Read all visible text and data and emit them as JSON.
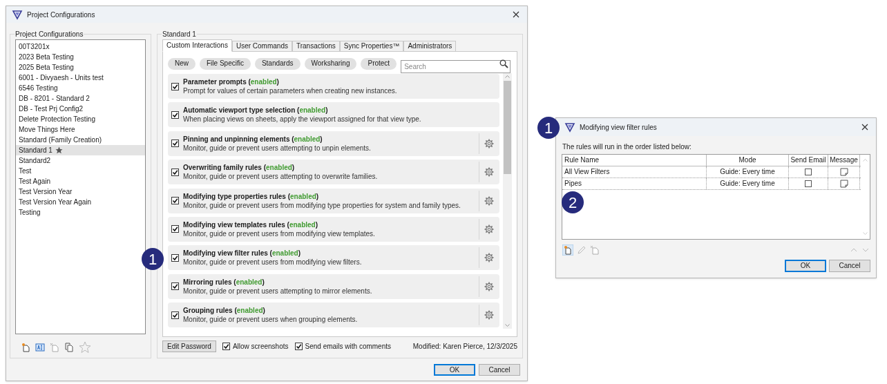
{
  "main_window": {
    "title": "Project Configurations",
    "configurations": {
      "title": "Project Configurations",
      "items": [
        {
          "label": "00T3201x",
          "selected": false,
          "starred": false
        },
        {
          "label": "2023 Beta Testing",
          "selected": false,
          "starred": false
        },
        {
          "label": "2025 Beta Testing",
          "selected": false,
          "starred": false
        },
        {
          "label": "6001 - Divyaesh - Units test",
          "selected": false,
          "starred": false
        },
        {
          "label": "6546 Testing",
          "selected": false,
          "starred": false
        },
        {
          "label": "DB - 8201 - Standard 2",
          "selected": false,
          "starred": false
        },
        {
          "label": "DB - Test Prj Config2",
          "selected": false,
          "starred": false
        },
        {
          "label": "Delete Protection Testing",
          "selected": false,
          "starred": false
        },
        {
          "label": "Move Things Here",
          "selected": false,
          "starred": false
        },
        {
          "label": "Standard (Family Creation)",
          "selected": false,
          "starred": false
        },
        {
          "label": "Standard 1",
          "selected": true,
          "starred": true
        },
        {
          "label": "Standard2",
          "selected": false,
          "starred": false
        },
        {
          "label": "Test",
          "selected": false,
          "starred": false
        },
        {
          "label": "Test Again",
          "selected": false,
          "starred": false
        },
        {
          "label": "Test Version Year",
          "selected": false,
          "starred": false
        },
        {
          "label": "Test Version Year Again",
          "selected": false,
          "starred": false
        },
        {
          "label": "Testing",
          "selected": false,
          "starred": false
        }
      ]
    },
    "details": {
      "title": "Standard 1",
      "tabs": [
        {
          "label": "Custom Interactions",
          "selected": true
        },
        {
          "label": "User Commands",
          "selected": false
        },
        {
          "label": "Transactions",
          "selected": false
        },
        {
          "label": "Sync Properties™",
          "selected": false
        },
        {
          "label": "Administrators",
          "selected": false
        }
      ],
      "filters": [
        "New",
        "File Specific",
        "Standards",
        "Worksharing",
        "Protect"
      ],
      "search": {
        "placeholder": "Search"
      },
      "rules": [
        {
          "title": "Parameter prompts",
          "status": "(enabled)",
          "description": "Prompt for values of certain parameters when creating new instances.",
          "checked": true,
          "settings": false
        },
        {
          "title": "Automatic viewport type selection",
          "status": "(enabled)",
          "description": "When placing views on sheets, apply the viewport assigned for that view type.",
          "checked": true,
          "settings": false
        },
        {
          "title": "Pinning and unpinning elements",
          "status": "(enabled)",
          "description": "Monitor, guide or prevent users attempting to unpin elements.",
          "checked": true,
          "settings": true
        },
        {
          "title": "Overwriting family rules",
          "status": "(enabled)",
          "description": "Monitor, guide or prevent users attempting to overwrite families.",
          "checked": true,
          "settings": true
        },
        {
          "title": "Modifying type properties rules",
          "status": "(enabled)",
          "description": "Monitor, guide or prevent users from modifying type properties for system and family types.",
          "checked": true,
          "settings": true
        },
        {
          "title": "Modifying view templates rules",
          "status": "(enabled)",
          "description": "Monitor, guide or prevent users from modifying view templates.",
          "checked": true,
          "settings": true
        },
        {
          "title": "Modifying view filter rules",
          "status": "(enabled)",
          "description": "Monitor, guide or prevent users from modifying view filters.",
          "checked": true,
          "settings": true
        },
        {
          "title": "Mirroring rules",
          "status": "(enabled)",
          "description": "Monitor, guide or prevent users attempting to mirror elements.",
          "checked": true,
          "settings": true
        },
        {
          "title": "Grouping rules",
          "status": "(enabled)",
          "description": "Monitor, guide or prevent users when grouping elements.",
          "checked": true,
          "settings": true
        }
      ],
      "edit_password": "Edit Password",
      "options": [
        {
          "label": "Allow screenshots",
          "checked": true
        },
        {
          "label": "Send emails with comments",
          "checked": true
        }
      ],
      "modified": "Modified: Karen Pierce, 12/3/2025"
    },
    "buttons": [
      "OK",
      "Cancel"
    ]
  },
  "dialog": {
    "title": "Modifying view filter rules",
    "instruction": "The rules will run in the order listed below:",
    "columns": [
      "Rule Name",
      "Mode",
      "Send Email",
      "Message"
    ],
    "rows": [
      {
        "name": "All View Filters",
        "mode": "Guide: Every time",
        "send_email": false
      },
      {
        "name": "Pipes",
        "mode": "Guide: Every time",
        "send_email": false
      }
    ],
    "buttons": [
      "OK",
      "Cancel"
    ]
  },
  "callouts": [
    {
      "label": "1"
    },
    {
      "label": "1"
    },
    {
      "label": "2"
    }
  ]
}
